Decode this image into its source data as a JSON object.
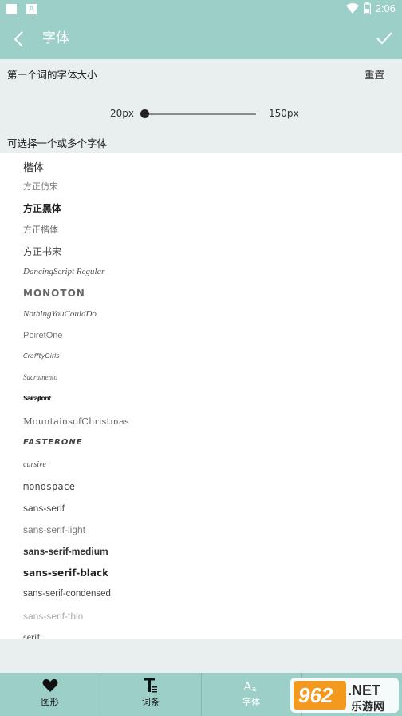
{
  "status": {
    "time": "2:06"
  },
  "header": {
    "title": "字体"
  },
  "settings": {
    "font_size_label": "第一个词的字体大小",
    "reset_label": "重置",
    "slider_min": "20px",
    "slider_max": "150px",
    "multi_select_label": "可选择一个或多个字体"
  },
  "fonts": [
    "楷体",
    "方正仿宋",
    "方正黑体",
    "方正楷体",
    "方正书宋",
    "DancingScript Regular",
    "Monoton",
    "NothingYouCouldDo",
    "PoiretOne",
    "CrafftyGirls",
    "Sacramento",
    "Sairajfont",
    "MountainsofChristmas",
    "FasterOne",
    "cursive",
    "monospace",
    "sans-serif",
    "sans-serif-light",
    "sans-serif-medium",
    "sans-serif-black",
    "sans-serif-condensed",
    "sans-serif-thin",
    "serif"
  ],
  "bottom_nav": {
    "items": [
      {
        "label": "图形",
        "icon": "heart-icon"
      },
      {
        "label": "词条",
        "icon": "text-entry-icon"
      },
      {
        "label": "字体",
        "icon": "font-icon"
      },
      {
        "label": "",
        "icon": ""
      }
    ]
  },
  "watermark": {
    "text_top": "962.NET",
    "text_bottom": "乐游网"
  },
  "colors": {
    "primary": "#9ccfc8",
    "background": "#e9eeee",
    "list_bg": "#ffffff"
  }
}
